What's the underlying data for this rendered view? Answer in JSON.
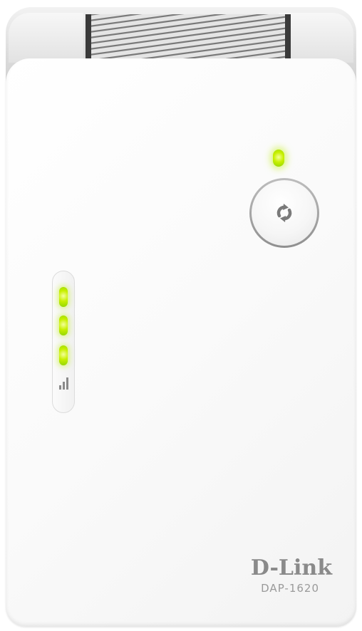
{
  "device": {
    "brand": "D-Link",
    "model": "DAP-1620",
    "led_color": "#c8f000",
    "body_color": "#ffffff",
    "cap_color": "#d8d8d8",
    "icons": {
      "wps": "wps-sync-icon",
      "signal": "signal-strength-icon"
    },
    "signal_leds_lit": 3,
    "signal_leds_total": 3
  }
}
